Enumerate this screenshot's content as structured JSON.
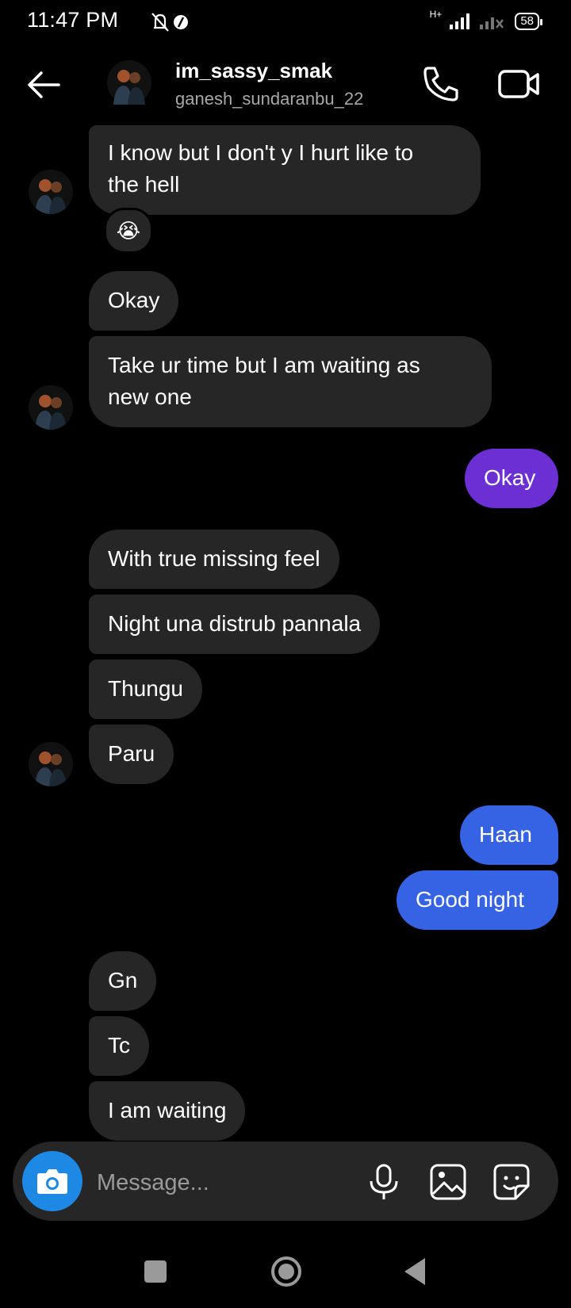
{
  "status_bar": {
    "time": "11:47 PM",
    "network": "H+",
    "battery": "58"
  },
  "header": {
    "name": "im_sassy_smak",
    "username": "ganesh_sundaranbu_22"
  },
  "messages": [
    {
      "text_line1": "I know but I don't y I hurt like to",
      "text_line2": "the hell",
      "reaction": "😭"
    },
    {
      "text": "Okay"
    },
    {
      "text_line1": "Take ur time but I am waiting as",
      "text_line2": "new one"
    },
    {
      "text": "Okay"
    },
    {
      "text": "With true missing feel"
    },
    {
      "text": "Night una distrub pannala"
    },
    {
      "text": "Thungu"
    },
    {
      "text": "Paru"
    },
    {
      "text": "Haan"
    },
    {
      "text": "Good night"
    },
    {
      "text": "Gn"
    },
    {
      "text": "Tc"
    },
    {
      "text": "I am waiting"
    }
  ],
  "composer": {
    "placeholder": "Message..."
  },
  "colors": {
    "received_bubble": "#262626",
    "sent_purple": "#6b2fd3",
    "sent_blue": "#3563e3",
    "camera_button": "#1e88e5"
  }
}
